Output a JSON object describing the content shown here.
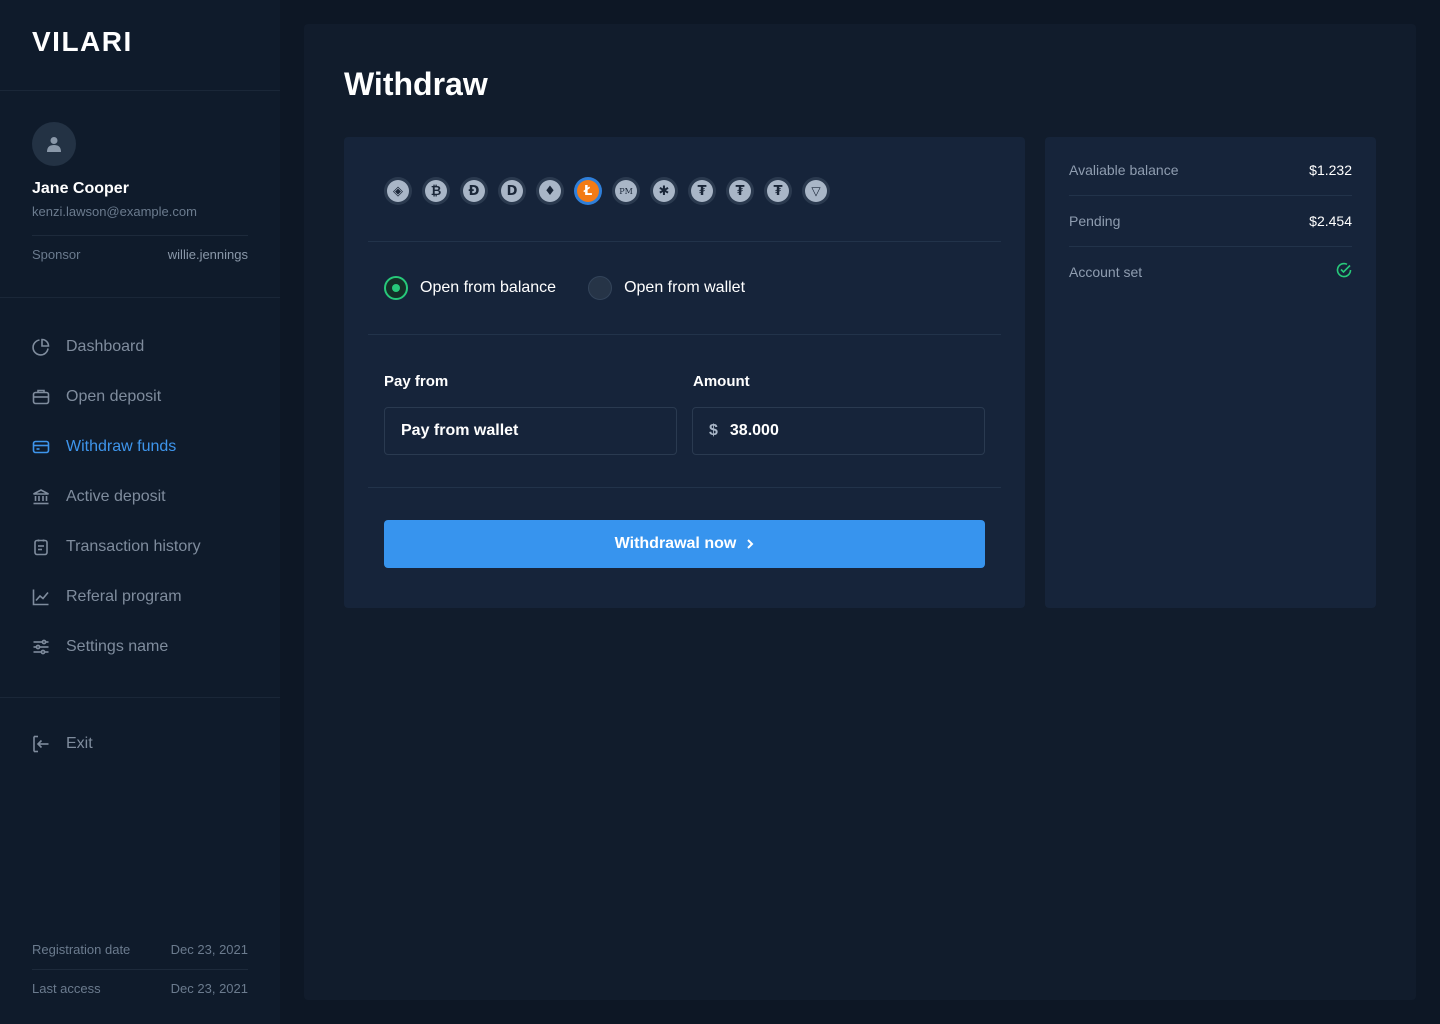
{
  "brand": {
    "logo": "VILARI"
  },
  "user": {
    "name": "Jane Cooper",
    "email": "kenzi.lawson@example.com",
    "sponsor_label": "Sponsor",
    "sponsor_value": "willie.jennings"
  },
  "nav": {
    "items": [
      {
        "label": "Dashboard",
        "icon": "pie-chart-icon"
      },
      {
        "label": "Open deposit",
        "icon": "briefcase-icon"
      },
      {
        "label": "Withdraw funds",
        "icon": "credit-card-icon",
        "active": true
      },
      {
        "label": "Active deposit",
        "icon": "bank-icon"
      },
      {
        "label": "Transaction history",
        "icon": "clipboard-icon"
      },
      {
        "label": "Referal program",
        "icon": "line-chart-icon"
      },
      {
        "label": "Settings name",
        "icon": "sliders-icon"
      }
    ],
    "exit_label": "Exit"
  },
  "meta": {
    "registration_label": "Registration date",
    "registration_value": "Dec 23, 2021",
    "last_access_label": "Last access",
    "last_access_value": "Dec 23, 2021"
  },
  "page": {
    "title": "Withdraw"
  },
  "coins": [
    {
      "icon": "binance-icon",
      "glyph": "◈"
    },
    {
      "icon": "bitcoin-icon",
      "glyph": "₿"
    },
    {
      "icon": "dash-icon",
      "glyph": "Ɖ"
    },
    {
      "icon": "dogecoin-icon",
      "glyph": "D"
    },
    {
      "icon": "ethereum-icon",
      "glyph": "♦"
    },
    {
      "icon": "litecoin-icon",
      "glyph": "Ł",
      "active": true
    },
    {
      "icon": "perfect-money-icon",
      "glyph": "PM"
    },
    {
      "icon": "ripple-icon",
      "glyph": "✱"
    },
    {
      "icon": "tether-icon",
      "glyph": "₮"
    },
    {
      "icon": "tether-icon",
      "glyph": "₮"
    },
    {
      "icon": "tether-icon",
      "glyph": "₮"
    },
    {
      "icon": "tron-icon",
      "glyph": "▽"
    }
  ],
  "options": {
    "balance_label": "Open from balance",
    "wallet_label": "Open from wallet",
    "selected": "balance"
  },
  "form": {
    "pay_from_label": "Pay from",
    "pay_from_value": "Pay from wallet",
    "amount_label": "Amount",
    "currency_symbol": "$",
    "amount_value": "38.000"
  },
  "button": {
    "label": "Withdrawal now"
  },
  "summary": {
    "available_label": "Avaliable balance",
    "available_value": "$1.232",
    "pending_label": "Pending",
    "pending_value": "$2.454",
    "account_label": "Account set",
    "account_status_icon": "check-circle-icon"
  },
  "colors": {
    "accent": "#3794ee",
    "success": "#27c97a",
    "active_coin": "#f37b15"
  }
}
